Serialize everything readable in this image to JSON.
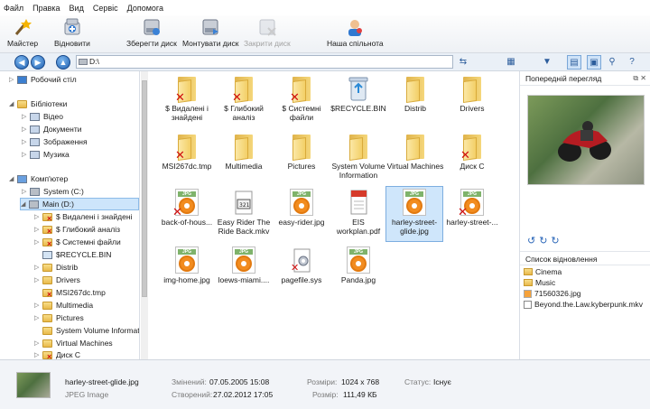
{
  "menu": [
    "Файл",
    "Правка",
    "Вид",
    "Сервіс",
    "Допомога"
  ],
  "toolbar": {
    "wizard": "Майстер",
    "recover": "Відновити",
    "save_disk": "Зберегти диск",
    "mount_disk": "Монтувати диск",
    "close_disk": "Закрити диск",
    "community": "Наша спільнота"
  },
  "address": {
    "value": "D:\\"
  },
  "tree": {
    "desktop": "Робочий стіл",
    "libraries": "Бібліотеки",
    "video": "Відео",
    "documents": "Документи",
    "images": "Зображення",
    "music": "Музика",
    "computer": "Комп'ютер",
    "system_c": "System (C:)",
    "main_d": "Main (D:)",
    "deleted_found": "$ Видалені і знайдені",
    "deep_analysis": "$ Глибокий аналіз",
    "system_files": "$ Системні файли",
    "recycle": "$RECYCLE.BIN",
    "distrib": "Distrib",
    "drivers": "Drivers",
    "msi": "MSI267dc.tmp",
    "multimedia": "Multimedia",
    "pictures": "Pictures",
    "svi": "System Volume Informati",
    "vms": "Virtual Machines",
    "disk_c": "Диск C"
  },
  "items": {
    "deleted_found": "$ Видалені і знайдені",
    "deep_analysis": "$ Глибокий аналіз",
    "system_files": "$ Системні файли",
    "recycle": "$RECYCLE.BIN",
    "distrib": "Distrib",
    "drivers": "Drivers",
    "msi": "MSI267dc.tmp",
    "multimedia": "Multimedia",
    "pictures": "Pictures",
    "svi": "System Volume Information",
    "vms": "Virtual Machines",
    "disk_c": "Диск C",
    "back_of_house": "back-of-hous...",
    "easy_rider_mkv": "Easy Rider The Ride Back.mkv",
    "easy_rider_jpg": "easy-rider.jpg",
    "eis_pdf": "EIS workplan.pdf",
    "harley": "harley-street-glide.jpg",
    "harley2": "harley-street-...",
    "img_home": "img-home.jpg",
    "loews": "loews-miami....",
    "pagefile": "pagefile.sys",
    "panda": "Panda.jpg",
    "jpg_tag": "JPG",
    "pdf_tag": "PDF",
    "mkv_tag": ".mkv"
  },
  "preview": {
    "title": "Попередній перегляд"
  },
  "recovery": {
    "title": "Список відновлення",
    "items": [
      "Cinema",
      "Music",
      "71560326.jpg",
      "Beyond.the.Law.kyberpunk.mkv"
    ]
  },
  "status": {
    "filename": "harley-street-glide.jpg",
    "type": "JPEG Image",
    "modified_label": "Змінений:",
    "modified": "07.05.2005 15:08",
    "created_label": "Створений:",
    "created": "27.02.2012 17:05",
    "dimensions_label": "Розміри:",
    "dimensions": "1024 x 768",
    "size_label": "Розмір:",
    "size": "111,49 КБ",
    "status_label": "Статус:",
    "status": "Існує"
  }
}
